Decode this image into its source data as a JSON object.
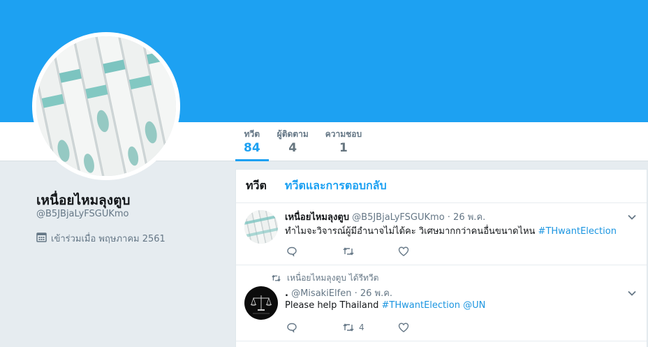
{
  "profile": {
    "name": "เหนื่อยไหมลุงตูบ",
    "handle": "@B5JBjaLyFSGUKmo",
    "joined": "เข้าร่วมเมื่อ พฤษภาคม 2561"
  },
  "nav": {
    "tweets_label": "ทวีต",
    "tweets_count": "84",
    "followers_label": "ผู้ติดตาม",
    "followers_count": "4",
    "likes_label": "ความชอบ",
    "likes_count": "1"
  },
  "timeline": {
    "tab_tweets": "ทวีต",
    "tab_replies": "ทวีตและการตอบกลับ"
  },
  "tweets": [
    {
      "fullname": "เหนื่อยไหมลุงตูบ",
      "handle": "@B5JBjaLyFSGUKmo",
      "date": "· 26 พ.ค.",
      "text": "ทำไมจะวิจารณ์ผู้มีอำนาจไม่ได้คะ วิเศษมากกว่าคนอื่นขนาดไหน",
      "hashtag": "#THwantElection"
    },
    {
      "retweet_context": "เหนื่อยไหมลุงตูบ ได้รีทวีต",
      "fullname": ".",
      "handle": "@MisakiElfen",
      "date": "· 26 พ.ค.",
      "text": "Please help Thailand",
      "hashtag": "#THwantElection",
      "mention": "@UN",
      "retweet_count": "4"
    }
  ],
  "colors": {
    "brand": "#1da1f2",
    "hashtag": "#1b95e0",
    "muted": "#657786"
  }
}
